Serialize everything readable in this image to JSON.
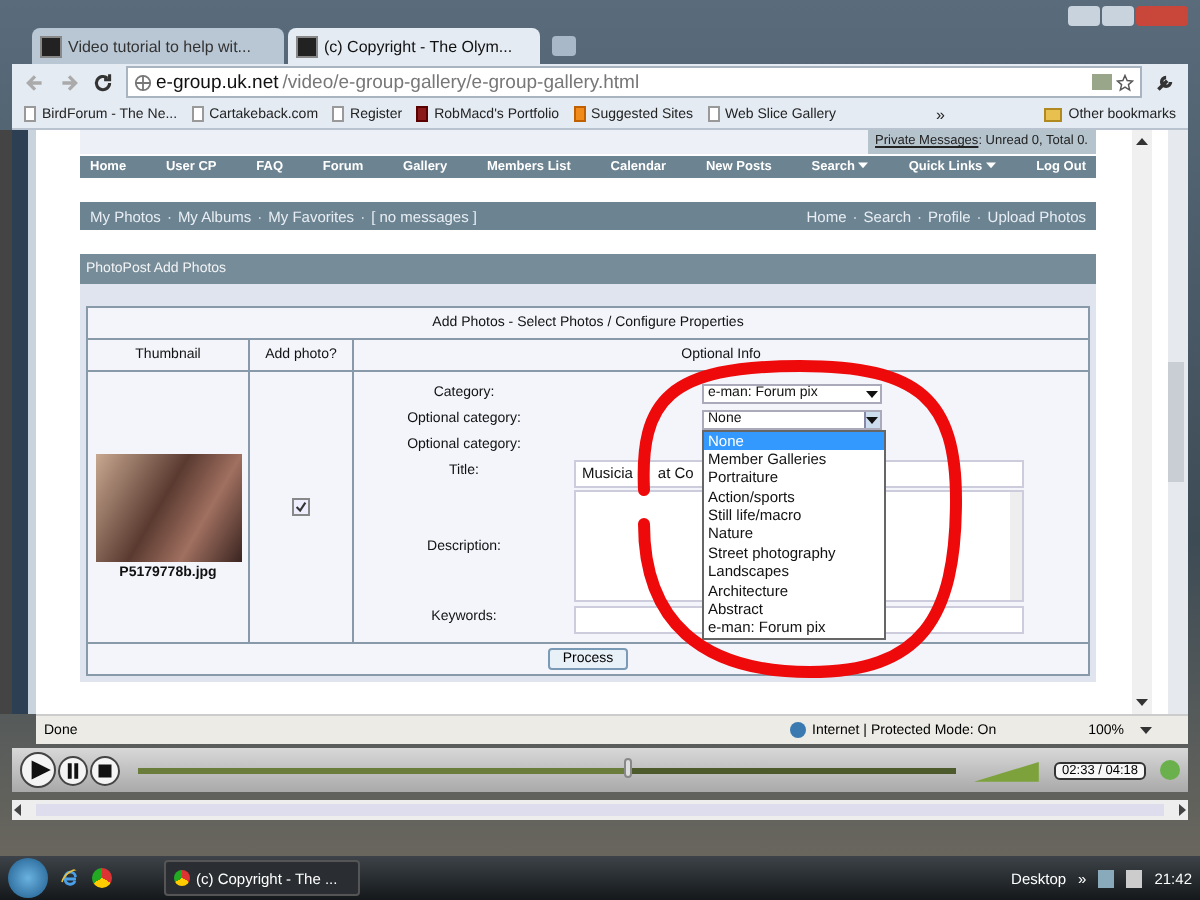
{
  "browser_tabs": [
    {
      "title": "Video tutorial to help wit...",
      "selected": false
    },
    {
      "title": "(c) Copyright - The Olym...",
      "selected": true
    }
  ],
  "address": {
    "domain": "e-group.uk.net",
    "path": "/video/e-group-gallery/e-group-gallery.html"
  },
  "bookmarks": [
    {
      "label": "BirdForum - The Ne...",
      "kind": "page"
    },
    {
      "label": "Cartakeback.com",
      "kind": "page"
    },
    {
      "label": "Register",
      "kind": "page"
    },
    {
      "label": "RobMacd's Portfolio",
      "kind": "logo"
    },
    {
      "label": "Suggested Sites",
      "kind": "suggested"
    },
    {
      "label": "Web Slice Gallery",
      "kind": "page"
    }
  ],
  "bookmarks_more": "»",
  "other_bookmarks": "Other bookmarks",
  "private_messages": {
    "link": "Private Messages",
    "text": ": Unread 0, Total 0."
  },
  "nav": [
    {
      "label": "Home",
      "dropdown": false
    },
    {
      "label": "User CP",
      "dropdown": false
    },
    {
      "label": "FAQ",
      "dropdown": false
    },
    {
      "label": "Forum",
      "dropdown": false
    },
    {
      "label": "Gallery",
      "dropdown": false
    },
    {
      "label": "Members List",
      "dropdown": false
    },
    {
      "label": "Calendar",
      "dropdown": false
    },
    {
      "label": "New Posts",
      "dropdown": false
    },
    {
      "label": "Search",
      "dropdown": true
    },
    {
      "label": "Quick Links",
      "dropdown": true
    },
    {
      "label": "Log Out",
      "dropdown": false
    }
  ],
  "subnav_separator": "·",
  "subnav_left": [
    "My Photos",
    "My Albums",
    "My Favorites",
    "[ no messages ]"
  ],
  "subnav_right": [
    "Home",
    "Search",
    "Profile",
    "Upload Photos"
  ],
  "panel_title": "PhotoPost Add Photos",
  "table": {
    "caption": "Add Photos - Select Photos / Configure Properties",
    "columns": [
      "Thumbnail",
      "Add photo?",
      "Optional Info"
    ],
    "filename": "P5179778b.jpg",
    "add_photo_checked": true,
    "fields": [
      {
        "label": "Category:",
        "kind": "select",
        "value": "e-man: Forum pix",
        "open": false
      },
      {
        "label": "Optional category:",
        "kind": "select",
        "value": "None",
        "open": true
      },
      {
        "label": "Optional category:",
        "kind": "covered"
      },
      {
        "label": "Title:",
        "kind": "text",
        "value": "Musicia      at Co"
      },
      {
        "label": "Description:",
        "kind": "textarea"
      },
      {
        "label": "Keywords:",
        "kind": "text"
      }
    ],
    "dropdown_options": [
      {
        "label": "None",
        "selected": true
      },
      {
        "label": "Member Galleries",
        "selected": false
      },
      {
        "label": "Portraiture",
        "selected": false
      },
      {
        "label": "Action/sports",
        "selected": false
      },
      {
        "label": "Still life/macro",
        "selected": false
      },
      {
        "label": "Nature",
        "selected": false
      },
      {
        "label": "Street photography",
        "selected": false
      },
      {
        "label": "Landscapes",
        "selected": false
      },
      {
        "label": "Architecture",
        "selected": false
      },
      {
        "label": "Abstract",
        "selected": false
      },
      {
        "label": "e-man: Forum pix",
        "selected": false
      }
    ],
    "button": "Process"
  },
  "status": {
    "text": "Done",
    "zone": "Internet | Protected Mode: On",
    "zoom": "100%"
  },
  "player": {
    "time": "02:33 / 04:18",
    "level": 0.6
  },
  "taskbar": {
    "task": "(c) Copyright - The ...",
    "desktop": "Desktop",
    "more": "»",
    "clock": "21:42"
  }
}
